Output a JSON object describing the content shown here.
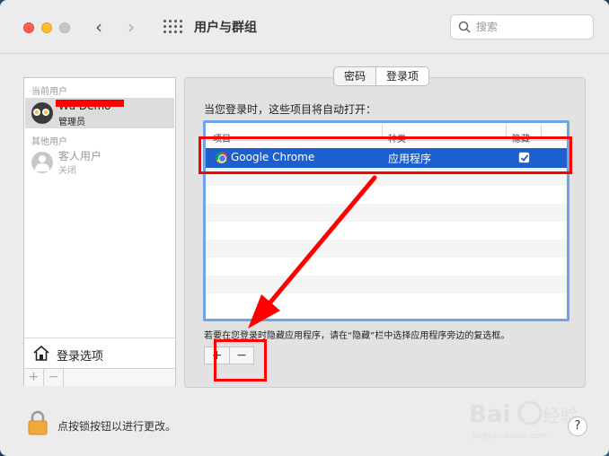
{
  "window": {
    "title": "用户与群组"
  },
  "search": {
    "placeholder": "搜索"
  },
  "sidebar": {
    "current_users_label": "当前用户",
    "current_user": {
      "name": "Wu Demo",
      "role": "管理员"
    },
    "other_users_label": "其他用户",
    "guest_user": {
      "name": "客人用户",
      "role": "关闭"
    },
    "login_options_label": "登录选项",
    "add_label": "+",
    "remove_label": "−"
  },
  "tabs": [
    {
      "label": "密码",
      "active": false
    },
    {
      "label": "登录项",
      "active": true
    }
  ],
  "login_items": {
    "intro": "当您登录时，这些项目将自动打开：",
    "columns": {
      "item": "项目",
      "kind": "种类",
      "hide": "隐藏"
    },
    "rows": [
      {
        "item": "Google Chrome",
        "kind": "应用程序",
        "hide": true
      }
    ],
    "hint": "若要在您登录时隐藏应用程序，请在“隐藏”栏中选择应用程序旁边的复选框。",
    "add_label": "+",
    "remove_label": "−"
  },
  "lock": {
    "label": "点按锁按钮以进行更改。"
  },
  "help": {
    "label": "?"
  },
  "colors": {
    "selection": "#1b5fd0",
    "annotation": "#ff0000",
    "table_border": "#6ea3e8"
  }
}
